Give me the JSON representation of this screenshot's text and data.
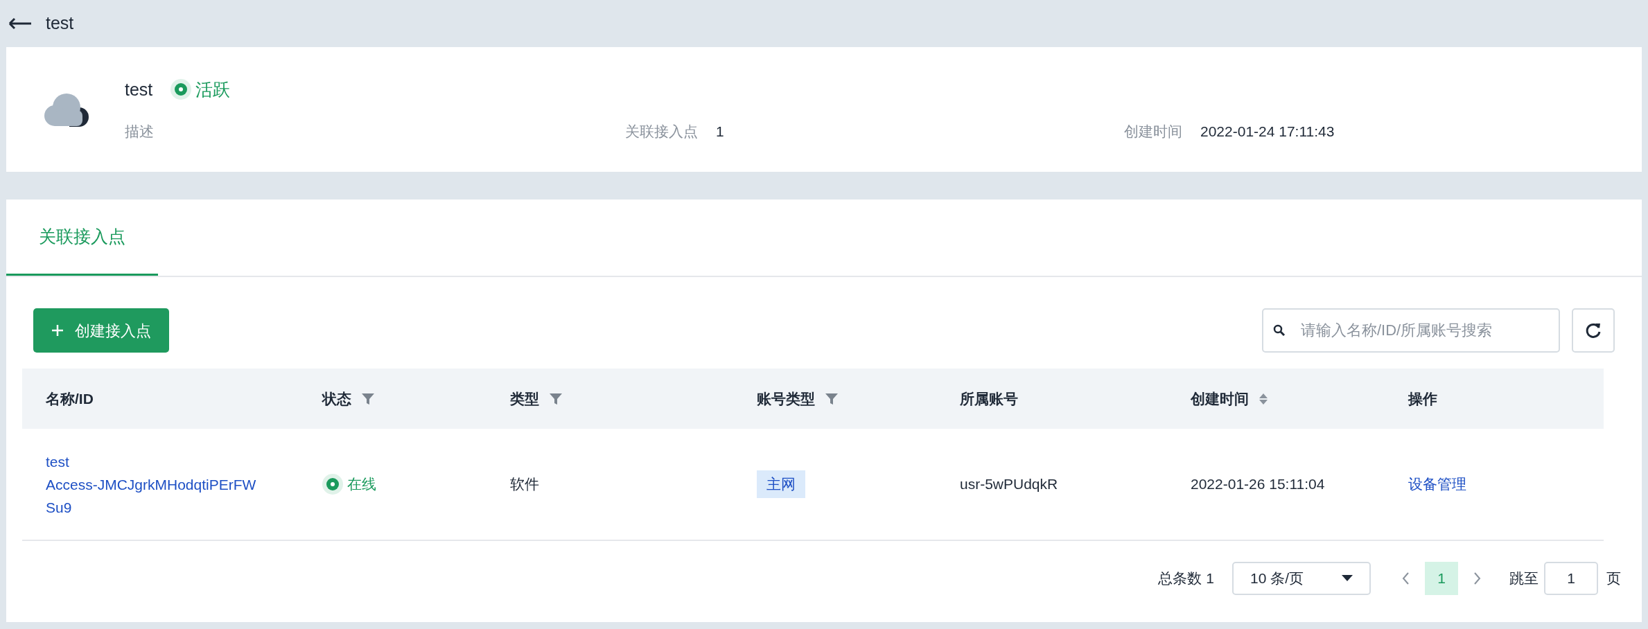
{
  "header": {
    "title": "test"
  },
  "summary": {
    "name": "test",
    "status": {
      "label": "活跃",
      "kind": "active"
    },
    "fields": [
      {
        "label": "描述"
      },
      {
        "label": "关联接入点",
        "value": "1"
      },
      {
        "label": "创建时间",
        "value": "2022-01-24 17:11:43"
      }
    ]
  },
  "tabs": [
    {
      "label": "关联接入点",
      "selected": true
    }
  ],
  "toolbar": {
    "create_button": "创建接入点",
    "search": {
      "placeholder": "请输入名称/ID/所属账号搜索"
    }
  },
  "table": {
    "columns": [
      {
        "label": "名称/ID",
        "filter": false,
        "sortable": false
      },
      {
        "label": "状态",
        "filter": true,
        "sortable": false
      },
      {
        "label": "类型",
        "filter": true,
        "sortable": false
      },
      {
        "label": "账号类型",
        "filter": true,
        "sortable": false
      },
      {
        "label": "所属账号",
        "filter": false,
        "sortable": false
      },
      {
        "label": "创建时间",
        "filter": false,
        "sortable": true
      },
      {
        "label": "操作",
        "filter": false,
        "sortable": false
      }
    ],
    "rows": [
      {
        "name": "test",
        "id": "Access-JMCJgrkMHodqtiPErFWSu9",
        "status": {
          "label": "在线",
          "kind": "online"
        },
        "type": "软件",
        "account_type": "主网",
        "account": "usr-5wPUdqkR",
        "created": "2022-01-26 15:11:04",
        "action": "设备管理"
      }
    ]
  },
  "pagination": {
    "total": "总条数 1",
    "page_size": "10 条/页",
    "pages": [
      {
        "label": "1",
        "selected": true
      }
    ],
    "jump_label": "跳至",
    "jump_value": "1",
    "jump_suffix": "页"
  }
}
